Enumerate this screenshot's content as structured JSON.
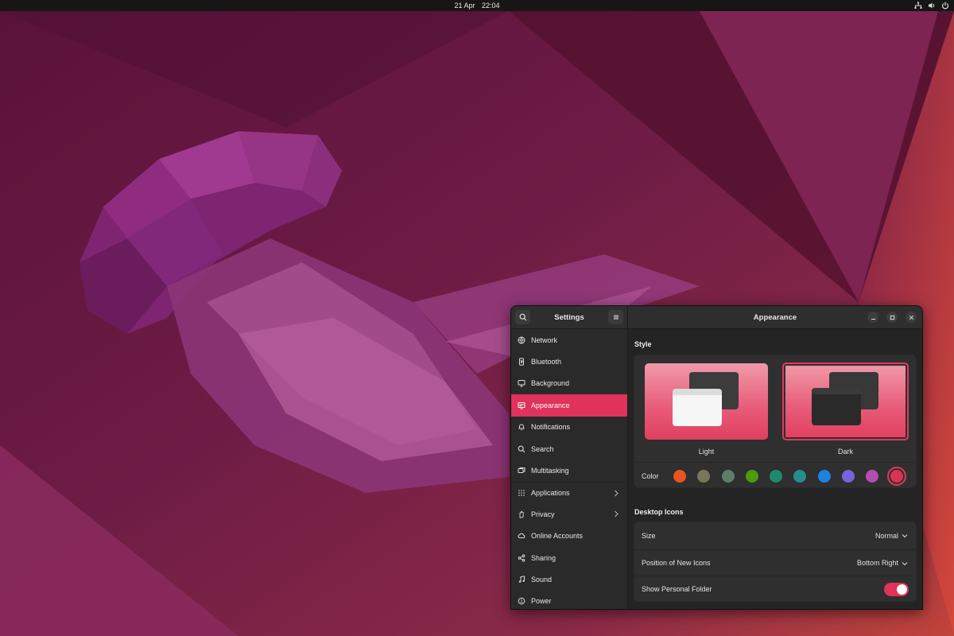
{
  "topbar": {
    "date": "21 Apr",
    "time": "22:04",
    "tray_icons": [
      "network-icon",
      "volume-icon",
      "power-icon"
    ]
  },
  "sidebar": {
    "title": "Settings",
    "items": [
      {
        "label": "Network",
        "icon": "globe-icon"
      },
      {
        "label": "Bluetooth",
        "icon": "bluetooth-icon"
      },
      {
        "label": "Background",
        "icon": "monitor-icon"
      },
      {
        "label": "Appearance",
        "icon": "appearance-icon",
        "active": true
      },
      {
        "label": "Notifications",
        "icon": "bell-icon"
      },
      {
        "label": "Search",
        "icon": "search-icon"
      },
      {
        "label": "Multitasking",
        "icon": "multitasking-icon"
      },
      {
        "label": "Applications",
        "icon": "grid-icon",
        "has_submenu": true
      },
      {
        "label": "Privacy",
        "icon": "hand-icon",
        "has_submenu": true
      },
      {
        "label": "Online Accounts",
        "icon": "cloud-icon"
      },
      {
        "label": "Sharing",
        "icon": "share-icon"
      },
      {
        "label": "Sound",
        "icon": "music-note-icon"
      },
      {
        "label": "Power",
        "icon": "power-icon"
      }
    ]
  },
  "content": {
    "title": "Appearance",
    "style_section": {
      "title": "Style",
      "themes": [
        {
          "label": "Light",
          "selected": false
        },
        {
          "label": "Dark",
          "selected": true
        }
      ],
      "color_label": "Color",
      "colors": [
        "#e95420",
        "#787859",
        "#5e7e68",
        "#4e9a06",
        "#1d8a70",
        "#268d8d",
        "#1c83e0",
        "#7764d8",
        "#b34cb3",
        "#da3450"
      ],
      "selected_color": "#da3450"
    },
    "desktop_icons": {
      "title": "Desktop Icons",
      "size_label": "Size",
      "size_value": "Normal",
      "position_label": "Position of New Icons",
      "position_value": "Bottom Right",
      "personal_folder_label": "Show Personal Folder",
      "personal_folder_on": true
    }
  },
  "colors": {
    "accent": "#e0325a",
    "window_bg": "#242424",
    "sidebar_bg": "#2a2a2a"
  }
}
